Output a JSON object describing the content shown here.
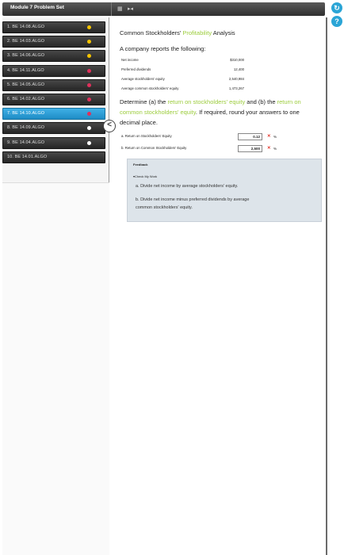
{
  "window": {
    "title": "Module 7 Problem Set"
  },
  "sidebar": {
    "items": [
      {
        "label": "1. BE 14.08.ALGO",
        "dot": "#f5c400",
        "active": false
      },
      {
        "label": "2. BE 14.03.ALGO",
        "dot": "#f5c400",
        "active": false
      },
      {
        "label": "3. BE 14.06.ALGO",
        "dot": "#f5c400",
        "active": false
      },
      {
        "label": "4. BE 14.11.ALGO",
        "dot": "#e0305b",
        "active": false
      },
      {
        "label": "5. BE 14.05.ALGO",
        "dot": "#e0305b",
        "active": false
      },
      {
        "label": "6. BE 14.02.ALGO",
        "dot": "#e0305b",
        "active": false
      },
      {
        "label": "7. BE 14.10.ALGO",
        "dot": "#e0305b",
        "active": true
      },
      {
        "label": "8. BE 14.09.ALGO",
        "dot": "#ffffff",
        "active": false
      },
      {
        "label": "9. BE 14.04.ALGO",
        "dot": "#ffffff",
        "active": false
      },
      {
        "label": "10. BE 14.01.ALGO",
        "dot": "",
        "active": false
      }
    ]
  },
  "main": {
    "heading_pre": "Common Stockholders' ",
    "heading_hl": "Profitability",
    "heading_post": " Analysis",
    "intro": "A company reports the following:",
    "financials": [
      {
        "label": "Net income",
        "value": "$310,000"
      },
      {
        "label": "Preferred dividends",
        "value": "12,400"
      },
      {
        "label": "Average stockholders' equity",
        "value": "2,540,984"
      },
      {
        "label": "Average common stockholders' equity",
        "value": "1,473,267"
      }
    ],
    "question": {
      "p1": "Determine (a) the ",
      "hl1": "return on stockholders' equity",
      "p2": " and (b) the ",
      "hl2": "return on common stockholders' equity",
      "p3": ". If required, round your answers to one decimal place."
    },
    "answers": [
      {
        "label": "a. Return on Stockholders' Equity",
        "value": "0.12",
        "unit": "%"
      },
      {
        "label": "b. Return on Common Stockholders' Equity",
        "value": "2,500",
        "unit": "%"
      }
    ],
    "feedback": {
      "label": "Feedback",
      "check": "Check My Work",
      "hint_a": "a. Divide net income by average stockholders' equity.",
      "hint_b1": "b. Divide net income minus preferred dividends by average",
      "hint_b2": "common stockholders' equity."
    }
  },
  "colors": {
    "accent": "#2ba5d6",
    "highlight": "#9ccc3c",
    "error": "#e3362b"
  }
}
